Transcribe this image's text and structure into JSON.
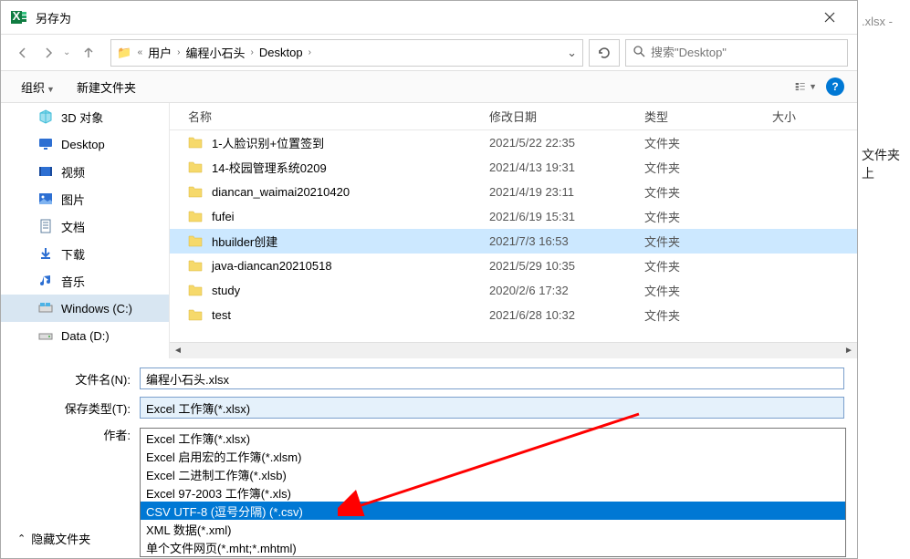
{
  "window": {
    "title": "另存为",
    "behind_title_suffix": ".xlsx -",
    "behind_text2": "文件夹上"
  },
  "breadcrumb": {
    "part1": "用户",
    "part2": "编程小石头",
    "part3": "Desktop"
  },
  "search": {
    "placeholder": "搜索\"Desktop\""
  },
  "toolbar": {
    "organize": "组织",
    "new_folder": "新建文件夹"
  },
  "sidebar": {
    "items": [
      {
        "label": "3D 对象",
        "icon": "cube",
        "color": "#3fbcd8"
      },
      {
        "label": "Desktop",
        "icon": "desktop",
        "color": "#2d6fd2"
      },
      {
        "label": "视频",
        "icon": "video",
        "color": "#2d6fd2"
      },
      {
        "label": "图片",
        "icon": "image",
        "color": "#2d6fd2"
      },
      {
        "label": "文档",
        "icon": "doc",
        "color": "#5f7f9f"
      },
      {
        "label": "下载",
        "icon": "download",
        "color": "#2d6fd2"
      },
      {
        "label": "音乐",
        "icon": "music",
        "color": "#2d6fd2"
      },
      {
        "label": "Windows (C:)",
        "icon": "drive-win",
        "color": "#4db3e6",
        "selected": true
      },
      {
        "label": "Data (D:)",
        "icon": "drive",
        "color": "#888"
      }
    ]
  },
  "columns": {
    "name": "名称",
    "date": "修改日期",
    "type": "类型",
    "size": "大小"
  },
  "files": [
    {
      "name": "1-人脸识别+位置签到",
      "date": "2021/5/22 22:35",
      "type": "文件夹"
    },
    {
      "name": "14-校园管理系统0209",
      "date": "2021/4/13 19:31",
      "type": "文件夹"
    },
    {
      "name": "diancan_waimai20210420",
      "date": "2021/4/19 23:11",
      "type": "文件夹"
    },
    {
      "name": "fufei",
      "date": "2021/6/19 15:31",
      "type": "文件夹"
    },
    {
      "name": "hbuilder创建",
      "date": "2021/7/3 16:53",
      "type": "文件夹",
      "selected": true
    },
    {
      "name": "java-diancan20210518",
      "date": "2021/5/29 10:35",
      "type": "文件夹"
    },
    {
      "name": "study",
      "date": "2020/2/6 17:32",
      "type": "文件夹"
    },
    {
      "name": "test",
      "date": "2021/6/28 10:32",
      "type": "文件夹"
    }
  ],
  "form": {
    "filename_label": "文件名(N):",
    "filename_value": "编程小石头.xlsx",
    "filetype_label": "保存类型(T):",
    "filetype_value": "Excel 工作簿(*.xlsx)",
    "author_label": "作者:"
  },
  "filetype_options": [
    "Excel 工作簿(*.xlsx)",
    "Excel 启用宏的工作簿(*.xlsm)",
    "Excel 二进制工作簿(*.xlsb)",
    "Excel 97-2003 工作簿(*.xls)",
    "CSV UTF-8 (逗号分隔) (*.csv)",
    "XML 数据(*.xml)",
    "单个文件网页(*.mht;*.mhtml)"
  ],
  "filetype_highlight_index": 4,
  "footer": {
    "hide_folders": "隐藏文件夹"
  }
}
